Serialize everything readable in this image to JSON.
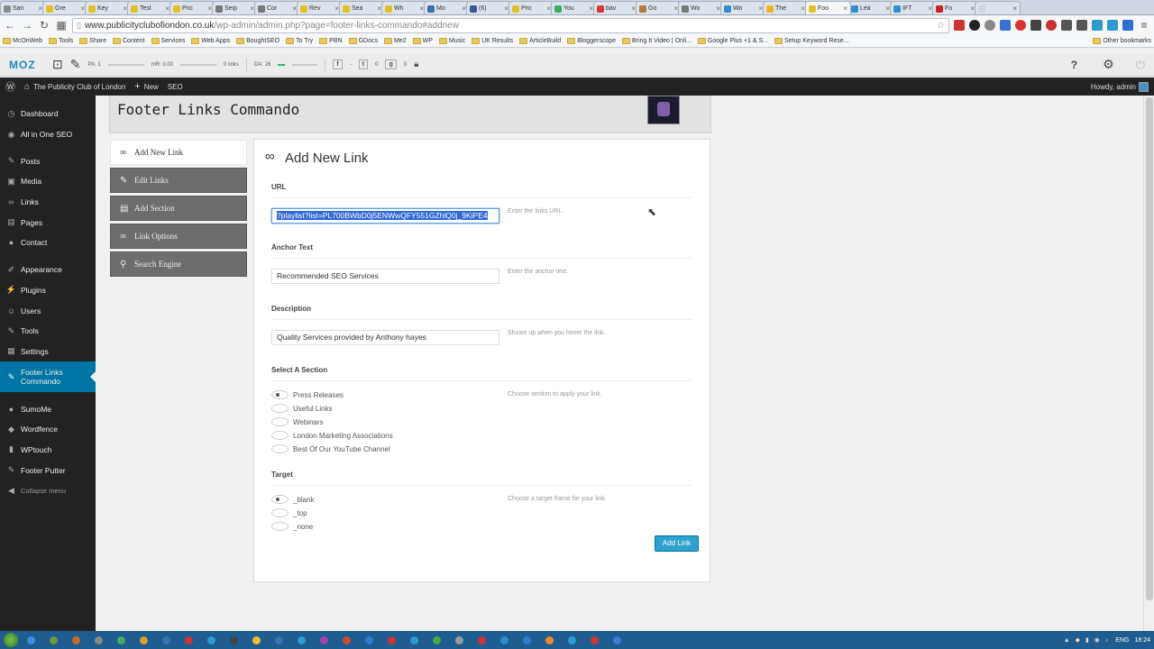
{
  "browser": {
    "tabs": [
      {
        "title": "San",
        "color": "#8a8a8a"
      },
      {
        "title": "Gre",
        "color": "#e2c229"
      },
      {
        "title": "Key",
        "color": "#e2c229"
      },
      {
        "title": "Test",
        "color": "#e2c229"
      },
      {
        "title": "Pric",
        "color": "#e2c229"
      },
      {
        "title": "Seip",
        "color": "#777777"
      },
      {
        "title": "Cor",
        "color": "#777777"
      },
      {
        "title": "Rev",
        "color": "#e2c229"
      },
      {
        "title": "Sea",
        "color": "#e2c229"
      },
      {
        "title": "Wh",
        "color": "#e2c229"
      },
      {
        "title": "Mo",
        "color": "#3a6fb0"
      },
      {
        "title": "(6)",
        "color": "#3b5998"
      },
      {
        "title": "Pric",
        "color": "#e2c229"
      },
      {
        "title": "You",
        "color": "#3cae64"
      },
      {
        "title": "bav",
        "color": "#d23b3b"
      },
      {
        "title": "Go",
        "color": "#b07a40"
      },
      {
        "title": "Wo",
        "color": "#777777"
      },
      {
        "title": "Wo",
        "color": "#2e8fd0"
      },
      {
        "title": "The",
        "color": "#f0b429"
      },
      {
        "title": "Foo",
        "color": "#e2c229",
        "active": true
      },
      {
        "title": "Lea",
        "color": "#2e8fd0"
      },
      {
        "title": "IFT",
        "color": "#2e8fd0"
      },
      {
        "title": "Fo",
        "color": "#cc2222"
      },
      {
        "title": "",
        "color": "#cfd6e1"
      }
    ],
    "url_host": "www.publicityclubofiondon.co.uk",
    "url_path": "/wp-admin/admin.php?page=footer-links-commando#addnew",
    "bookmarks": [
      "McOnWeb",
      "Tools",
      "Share",
      "Content",
      "Services",
      "Web Apps",
      "BoughtSEO",
      "To Try",
      "PBN",
      "GDocs",
      "Me2",
      "WP",
      "Music",
      "UK Results",
      "ArticleBuild",
      "Bloggerscope",
      "Bring It Video | Onli...",
      "Google Plus +1 & S...",
      "Setup Keyword Rese..."
    ],
    "other_bookmarks": "Other bookmarks"
  },
  "mozbar": {
    "logo": "MOZ",
    "pa_label": "PA: 1",
    "mozrank_label": "mR: 0.00",
    "links_label": "0 links",
    "da_label": "DA: 26",
    "facebook_count": "-",
    "twitter_count": "0",
    "gplus_count": "0"
  },
  "admin_bar": {
    "site_name": "The Publicity Club of London",
    "new_label": "New",
    "seo_label": "SEO",
    "howdy": "Howdy, admin"
  },
  "sidebar": {
    "items": [
      {
        "label": "Dashboard",
        "icon": "dashboard-icon",
        "glyph": "◷"
      },
      {
        "label": "All in One SEO",
        "icon": "seo-icon",
        "glyph": "◉"
      },
      {
        "label": "Posts",
        "icon": "pin-icon",
        "glyph": "✎",
        "sep": true
      },
      {
        "label": "Media",
        "icon": "media-icon",
        "glyph": "▣"
      },
      {
        "label": "Links",
        "icon": "link-icon",
        "glyph": "∞"
      },
      {
        "label": "Pages",
        "icon": "page-icon",
        "glyph": "▤"
      },
      {
        "label": "Contact",
        "icon": "contact-icon",
        "glyph": "●"
      },
      {
        "label": "Appearance",
        "icon": "brush-icon",
        "glyph": "✐",
        "sep": true
      },
      {
        "label": "Plugins",
        "icon": "plugin-icon",
        "glyph": "⚡"
      },
      {
        "label": "Users",
        "icon": "user-icon",
        "glyph": "☺"
      },
      {
        "label": "Tools",
        "icon": "wrench-icon",
        "glyph": "✎"
      },
      {
        "label": "Settings",
        "icon": "settings-icon",
        "glyph": "▦"
      },
      {
        "label": "Footer Links Commando",
        "icon": "pin-icon",
        "glyph": "✎",
        "active": true
      },
      {
        "label": "SumoMe",
        "icon": "sumome-icon",
        "glyph": "●",
        "sep": true
      },
      {
        "label": "Wordfence",
        "icon": "wordfence-icon",
        "glyph": "◆"
      },
      {
        "label": "WPtouch",
        "icon": "wptouch-icon",
        "glyph": "▮"
      },
      {
        "label": "Footer Putter",
        "icon": "putter-icon",
        "glyph": "✎"
      },
      {
        "label": "Collapse menu",
        "icon": "collapse-icon",
        "glyph": "◀"
      }
    ]
  },
  "plugin": {
    "title": "Footer Links Commando",
    "tabs": [
      {
        "label": "Add New Link",
        "icon": "link-icon",
        "glyph": "∞",
        "active": true
      },
      {
        "label": "Edit Links",
        "icon": "pencil-icon",
        "glyph": "✎"
      },
      {
        "label": "Add Section",
        "icon": "section-icon",
        "glyph": "▤"
      },
      {
        "label": "Link Options",
        "icon": "options-icon",
        "glyph": "∞"
      },
      {
        "label": "Search Engine",
        "icon": "search-icon",
        "glyph": "⚲"
      }
    ]
  },
  "form": {
    "heading": "Add New Link",
    "url_label": "URL",
    "url_value": "?playlist?list=PL700BWbD0j5ENWwQFY551GZhlQ0j_9KiPE4",
    "url_help": "Enter the links URL.",
    "anchor_label": "Anchor Text",
    "anchor_value": "Recommended SEO Services",
    "anchor_help": "Enter the anchor text.",
    "desc_label": "Description",
    "desc_value": "Quality Services provided by Anthony hayes",
    "desc_help": "Shown up when you hover the link.",
    "section_label": "Select A Section",
    "section_help": "Choose section to apply your link.",
    "sections": [
      {
        "label": "Press Releases",
        "checked": true
      },
      {
        "label": "Useful Links",
        "checked": false
      },
      {
        "label": "Webinars",
        "checked": false
      },
      {
        "label": "London Marketing Associations",
        "checked": false
      },
      {
        "label": "Best Of Our YouTube Channel",
        "checked": false
      }
    ],
    "target_label": "Target",
    "target_help": "Choose a target frame for your link.",
    "targets": [
      {
        "label": "_blank",
        "checked": true
      },
      {
        "label": "_top",
        "checked": false
      },
      {
        "label": "_none",
        "checked": false
      }
    ],
    "submit_label": "Add Link"
  },
  "taskbar": {
    "apps": [
      "#3a8fd8",
      "#6a9a3a",
      "#c86a2a",
      "#888888",
      "#44aa66",
      "#d8a030",
      "#3a6fb0",
      "#cc3333",
      "#2a9ad8",
      "#444444",
      "#f0c030",
      "#3a6fb0",
      "#2e9ad0",
      "#aa44aa",
      "#d04a2a",
      "#2a7ad0",
      "#cc3333",
      "#2e9ad0",
      "#44aa44",
      "#999999",
      "#cc3333",
      "#2a8ad0",
      "#2a7ad0",
      "#ee8833",
      "#2a9ad8",
      "#cc3333",
      "#3a7ad0"
    ],
    "lang": "ENG",
    "time": "18:24"
  }
}
